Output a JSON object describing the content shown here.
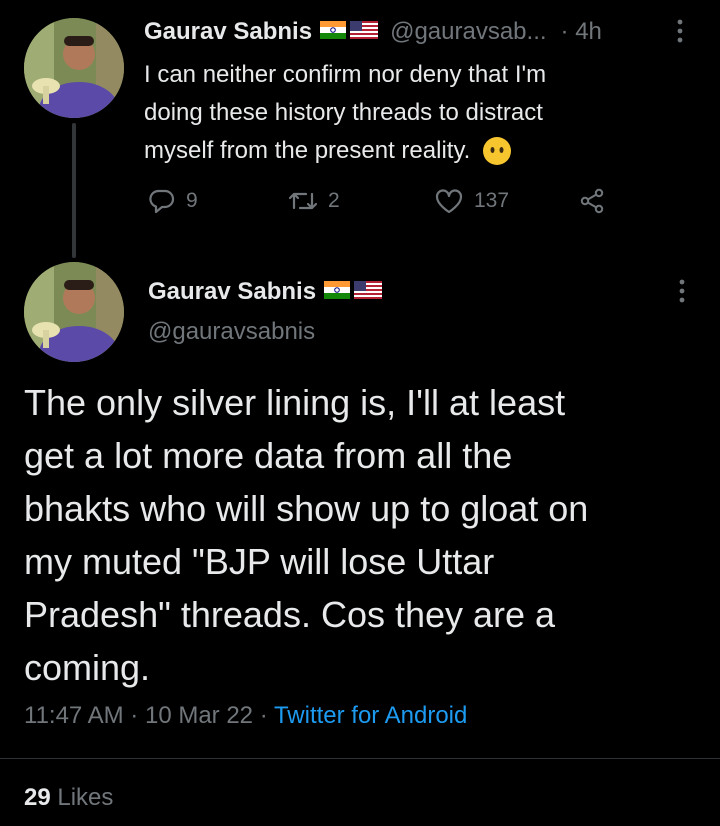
{
  "tweet1": {
    "name": "Gaurav Sabnis",
    "handle": "@gauravsab...",
    "time": "· 4h",
    "text_lines": [
      "I can neither confirm nor deny that I'm",
      "doing these history threads to distract",
      "myself from the present reality."
    ],
    "emoji": "face-without-mouth",
    "actions": {
      "replies": "9",
      "retweets": "2",
      "likes": "137"
    }
  },
  "tweet2": {
    "name": "Gaurav Sabnis",
    "handle": "@gauravsabnis",
    "text_lines": [
      "The only silver lining is, I'll at least",
      "get a lot more data from all the",
      "bhakts who will show up to gloat on",
      "my muted \"BJP will lose Uttar",
      "Pradesh\" threads. Cos they are a",
      "coming."
    ],
    "time": "11:47 AM",
    "date": "10 Mar 22",
    "separator": "·",
    "source": "Twitter for Android",
    "likes_count": "29",
    "likes_label": "Likes"
  },
  "colors": {
    "background": "#000000",
    "text": "#e7e9ea",
    "muted": "#71767b",
    "link": "#1d9bf0"
  }
}
